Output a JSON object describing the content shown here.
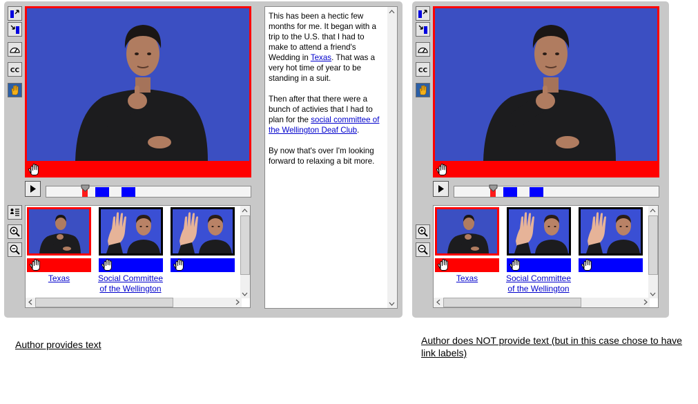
{
  "left_panel": {
    "text_pane": {
      "para1_before": "This has been a hectic few months for me. It began with a trip to the U.S. that I had to make to attend a friend's Wedding in ",
      "para1_link": "Texas",
      "para1_after": ". That was a very hot time of year to be standing in a suit.",
      "para2_before": "Then after that there were a bunch of activies that I had to plan for the ",
      "para2_link": "social committee of the Wellington Deaf Club",
      "para2_after": ".",
      "para3": "By now that's over I'm looking forward to relaxing a bit more."
    },
    "thumbs": [
      {
        "label": "Texas"
      },
      {
        "label": "Social Committee of the Wellington"
      },
      {
        "label": ""
      }
    ],
    "caption": "Author provides text"
  },
  "right_panel": {
    "thumbs": [
      {
        "label": "Texas"
      },
      {
        "label": "Social Committee of the Wellington"
      },
      {
        "label": ""
      }
    ],
    "caption": "Author does NOT provide text (but in this case chose to have link labels)"
  },
  "icons": {
    "tool_1": "move-left-icon",
    "tool_2": "move-right-icon",
    "tool_3": "speed-gauge-icon",
    "tool_4": "closed-captions-icon",
    "tool_5": "sign-hand-icon",
    "list_view": "list-view-icon",
    "zoom_in": "zoom-in-icon",
    "zoom_out": "zoom-out-icon",
    "play": "play-icon",
    "hand_link": "hand-pointer-icon"
  },
  "colors": {
    "video_bg": "#3b4fc2",
    "selected_link": "#ff0000",
    "link_marker": "#0000ff",
    "panel_bg": "#c8c8c8",
    "active_tool": "#2b5fa7"
  }
}
